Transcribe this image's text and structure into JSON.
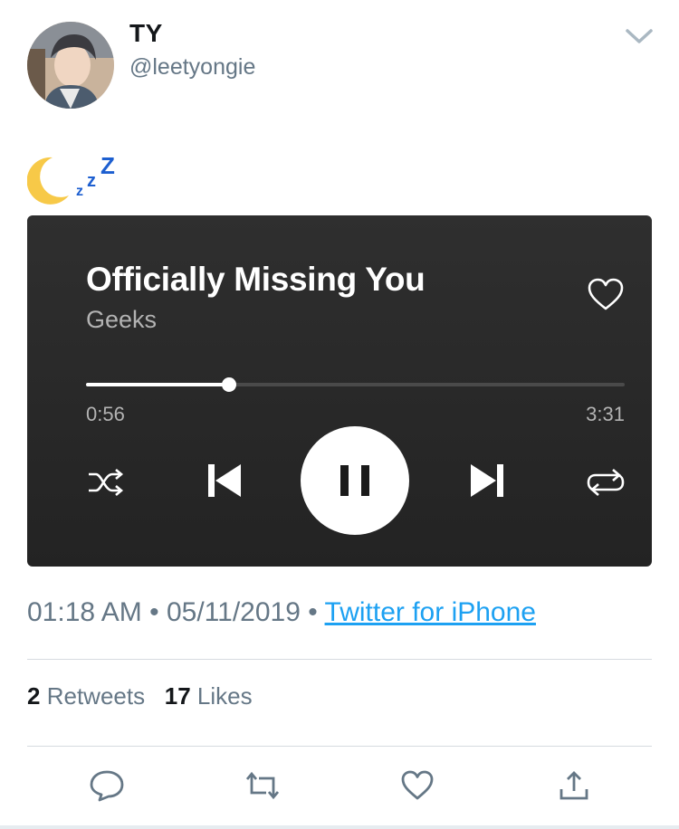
{
  "tweet": {
    "author": {
      "name": "TY",
      "handle": "@leetyongie"
    },
    "text_emoji": "moon-and-zzz",
    "timestamp": "01:18 AM",
    "date": "05/11/2019",
    "separator": "•",
    "source": "Twitter for iPhone",
    "stats": {
      "retweets": "2",
      "retweets_label": "Retweets",
      "likes": "17",
      "likes_label": "Likes"
    }
  },
  "player": {
    "song": "Officially Missing You",
    "artist": "Geeks",
    "current_time": "0:56",
    "total_time": "3:31",
    "progress": 0.265
  },
  "colors": {
    "accent": "#1da1f2",
    "player_bg": "#262626",
    "muted_text": "#657786"
  },
  "icons": {
    "caret": "chevron-down-icon",
    "heart": "heart-icon",
    "shuffle": "shuffle-icon",
    "previous": "skip-previous-icon",
    "pause": "pause-icon",
    "next": "skip-next-icon",
    "repeat": "repeat-icon",
    "reply": "reply-icon",
    "retweet": "retweet-icon",
    "like": "like-icon",
    "share": "share-icon"
  }
}
